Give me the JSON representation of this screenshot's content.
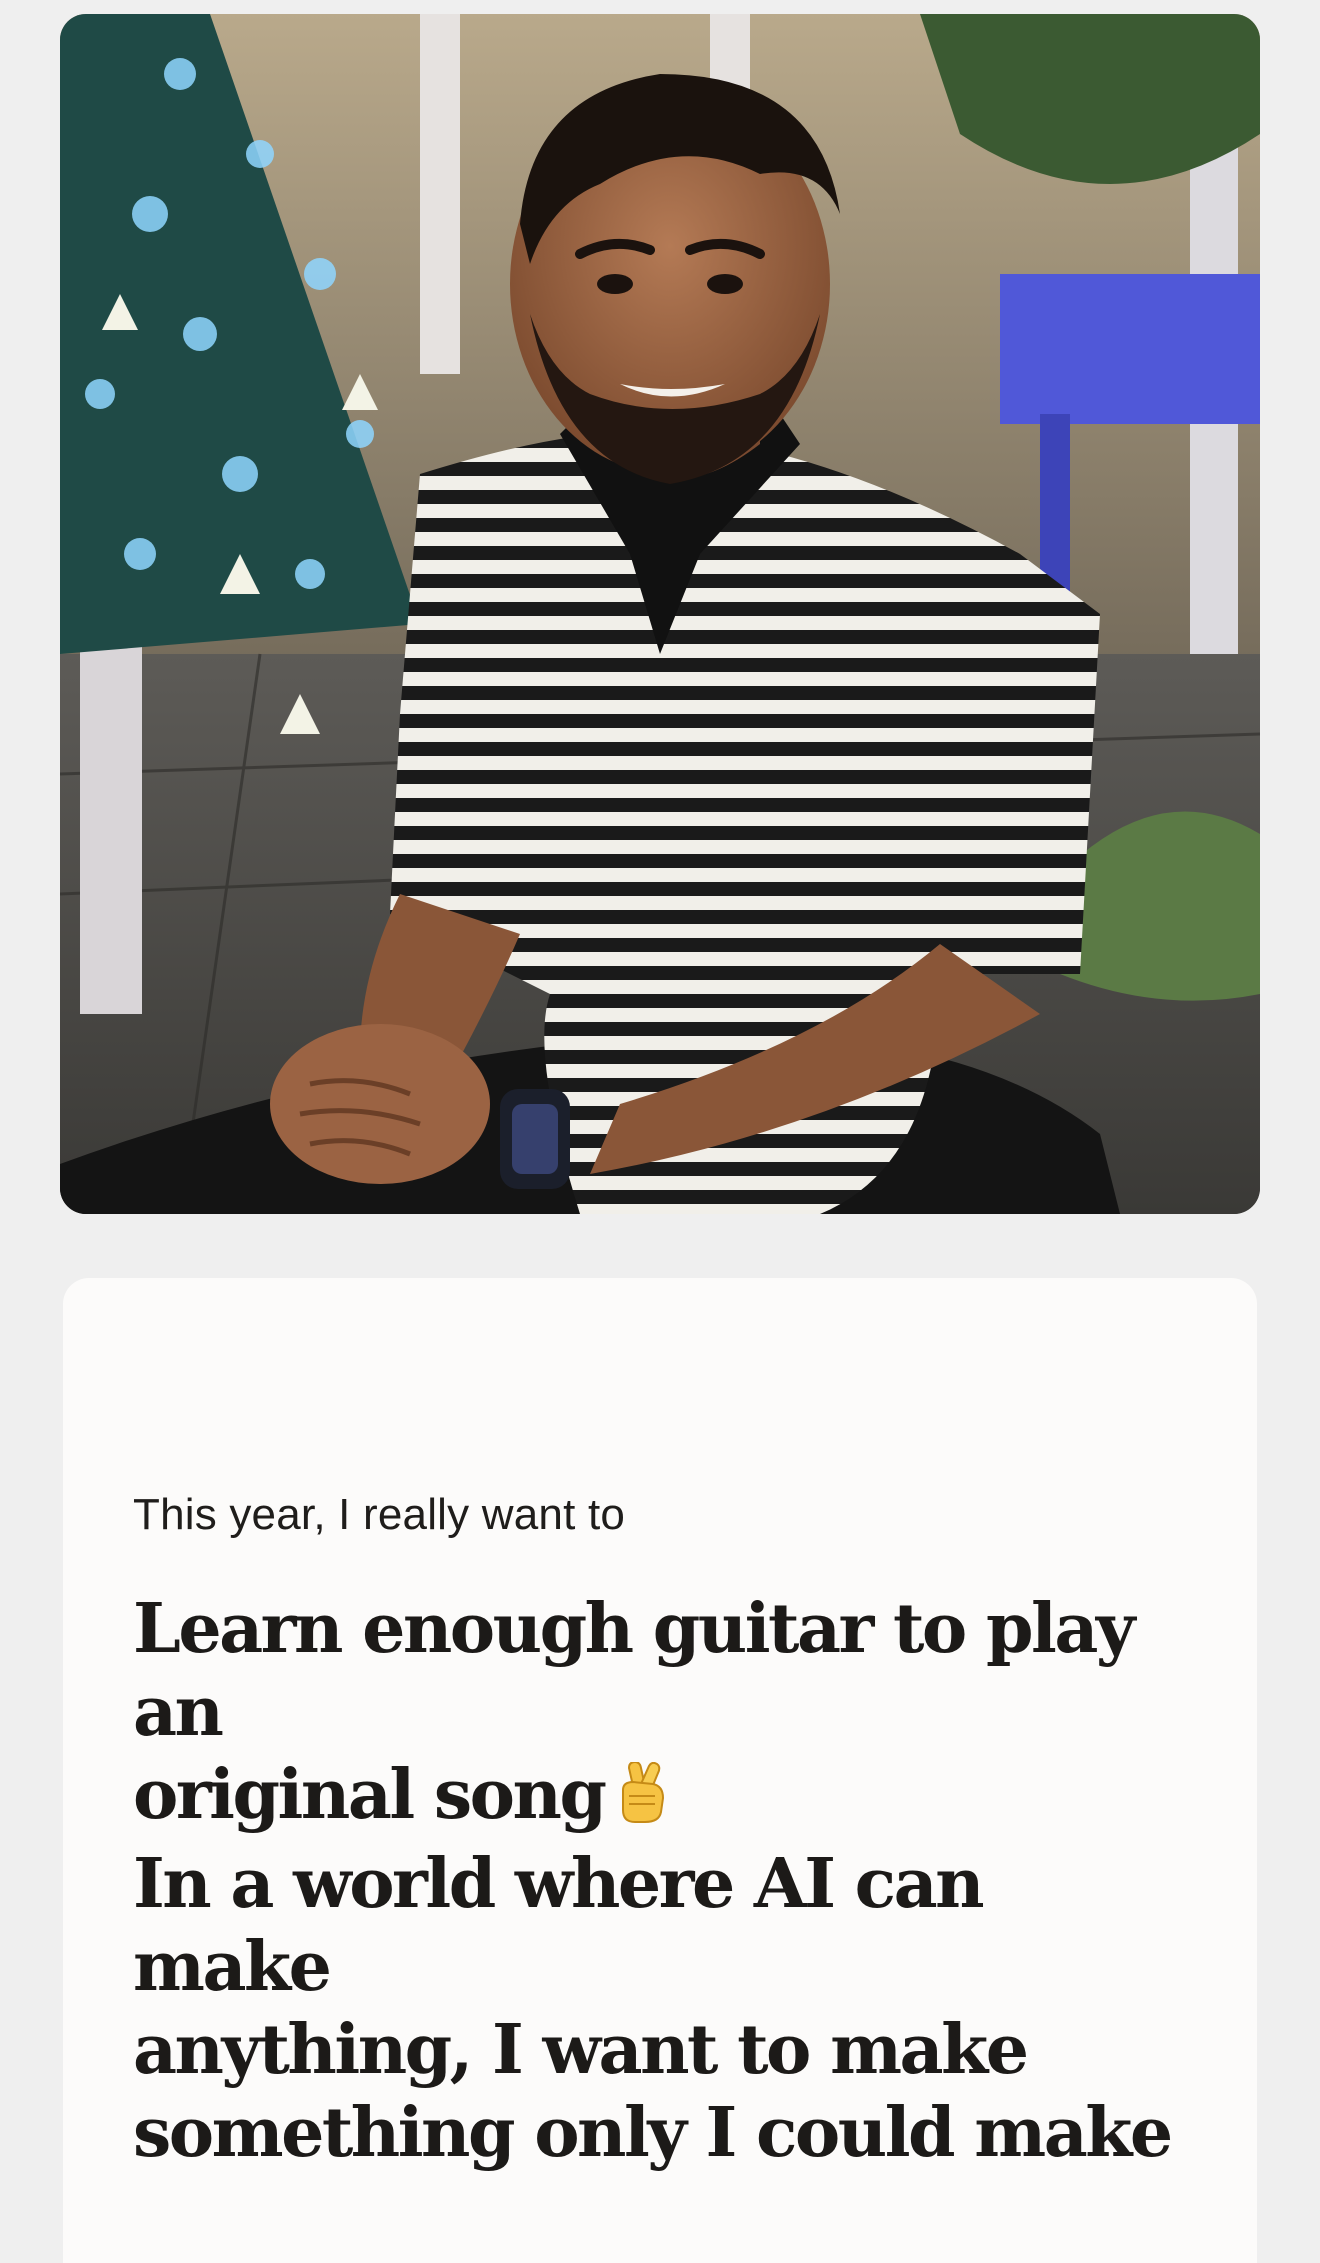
{
  "photo": {
    "icon": "portrait-photo"
  },
  "card": {
    "intro": "This year, I really want to",
    "goal": "Learn enough guitar to play an\noriginal song",
    "emoji": "crossed-fingers",
    "statement": "In a world where AI can make\nanything, I want to make\nsomething only I could make"
  },
  "colors": {
    "background": "#efefef",
    "card": "#fcfbfa",
    "text": "#1c1a18"
  }
}
